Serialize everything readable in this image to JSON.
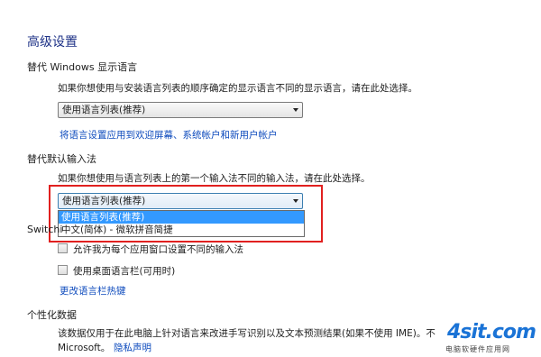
{
  "page": {
    "title": "高级设置"
  },
  "display_language": {
    "heading": "替代 Windows 显示语言",
    "description": "如果你想使用与安装语言列表的顺序确定的显示语言不同的显示语言，请在此处选择。",
    "selected": "使用语言列表(推荐)",
    "apply_link": "将语言设置应用到欢迎屏幕、系统帐户和新用户帐户"
  },
  "input_method": {
    "heading": "替代默认输入法",
    "description": "如果你想使用与语言列表上的第一个输入法不同的输入法，请在此处选择。",
    "selected": "使用语言列表(推荐)",
    "options": [
      "使用语言列表(推荐)",
      "中文(简体) - 微软拼音简捷"
    ]
  },
  "switching": {
    "heading_partial": "Switchi",
    "per_app_label": "允许我为每个应用窗口设置不同的输入法",
    "desktop_bar_label": "使用桌面语言栏(可用时)",
    "hotkeys_link": "更改语言栏热键"
  },
  "personalization": {
    "heading": "个性化数据",
    "description": "该数据仅用于在此电脑上针对语言来改进手写识别以及文本预测结果(如果不使用 IME)。不",
    "microsoft": "Microsoft。",
    "privacy_link": "隐私声明"
  },
  "watermark": {
    "main": "4sit.com",
    "sub": "电脑软硬件应用网"
  },
  "colors": {
    "title": "#1e3287",
    "link": "#0e4bbd",
    "highlight": "#e1201f",
    "selection": "#3399ff"
  }
}
